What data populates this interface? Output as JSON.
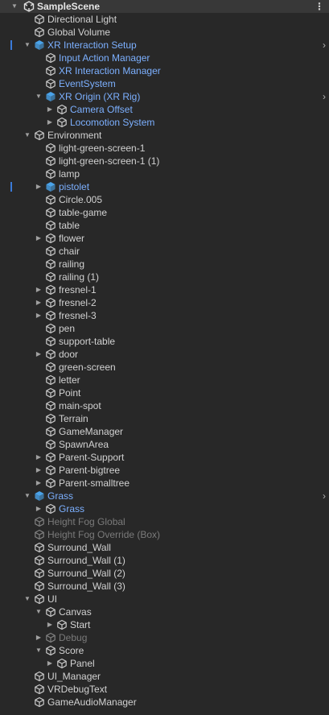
{
  "hierarchy": {
    "scene_name": "SampleScene",
    "menu_glyph": "⋮",
    "open_arrow": "▼",
    "closed_arrow": "▶",
    "prefab_enter_arrow": "›",
    "items": [
      {
        "label": "Directional Light",
        "depth": 1,
        "kind": "go"
      },
      {
        "label": "Global Volume",
        "depth": 1,
        "kind": "go"
      },
      {
        "label": "XR Interaction Setup",
        "depth": 1,
        "kind": "prefab",
        "expand": "open",
        "enter": true,
        "gutter": true
      },
      {
        "label": "Input Action Manager",
        "depth": 2,
        "kind": "go",
        "text": "prefab"
      },
      {
        "label": "XR Interaction Manager",
        "depth": 2,
        "kind": "go",
        "text": "prefab"
      },
      {
        "label": "EventSystem",
        "depth": 2,
        "kind": "go",
        "text": "prefab"
      },
      {
        "label": "XR Origin (XR Rig)",
        "depth": 2,
        "kind": "prefab",
        "expand": "open",
        "enter": true
      },
      {
        "label": "Camera Offset",
        "depth": 3,
        "kind": "go",
        "text": "prefab",
        "expand": "closed"
      },
      {
        "label": "Locomotion System",
        "depth": 3,
        "kind": "go",
        "text": "prefab",
        "expand": "closed"
      },
      {
        "label": "Environment",
        "depth": 1,
        "kind": "go",
        "expand": "open"
      },
      {
        "label": "light-green-screen-1",
        "depth": 2,
        "kind": "go"
      },
      {
        "label": "light-green-screen-1 (1)",
        "depth": 2,
        "kind": "go"
      },
      {
        "label": "lamp",
        "depth": 2,
        "kind": "go"
      },
      {
        "label": "pistolet",
        "depth": 2,
        "kind": "prefab-variant",
        "expand": "closed",
        "gutter": true
      },
      {
        "label": "Circle.005",
        "depth": 2,
        "kind": "go"
      },
      {
        "label": "table-game",
        "depth": 2,
        "kind": "go"
      },
      {
        "label": "table",
        "depth": 2,
        "kind": "go"
      },
      {
        "label": "flower",
        "depth": 2,
        "kind": "go",
        "expand": "closed"
      },
      {
        "label": "chair",
        "depth": 2,
        "kind": "go"
      },
      {
        "label": "railing",
        "depth": 2,
        "kind": "go"
      },
      {
        "label": "railing (1)",
        "depth": 2,
        "kind": "go"
      },
      {
        "label": "fresnel-1",
        "depth": 2,
        "kind": "go",
        "expand": "closed"
      },
      {
        "label": "fresnel-2",
        "depth": 2,
        "kind": "go",
        "expand": "closed"
      },
      {
        "label": "fresnel-3",
        "depth": 2,
        "kind": "go",
        "expand": "closed"
      },
      {
        "label": "pen",
        "depth": 2,
        "kind": "go"
      },
      {
        "label": "support-table",
        "depth": 2,
        "kind": "go"
      },
      {
        "label": "door",
        "depth": 2,
        "kind": "go",
        "expand": "closed"
      },
      {
        "label": "green-screen",
        "depth": 2,
        "kind": "go"
      },
      {
        "label": "letter",
        "depth": 2,
        "kind": "go"
      },
      {
        "label": "Point",
        "depth": 2,
        "kind": "go"
      },
      {
        "label": "main-spot",
        "depth": 2,
        "kind": "go"
      },
      {
        "label": "Terrain",
        "depth": 2,
        "kind": "go"
      },
      {
        "label": "GameManager",
        "depth": 2,
        "kind": "go"
      },
      {
        "label": "SpawnArea",
        "depth": 2,
        "kind": "go"
      },
      {
        "label": "Parent-Support",
        "depth": 2,
        "kind": "go",
        "expand": "closed"
      },
      {
        "label": "Parent-bigtree",
        "depth": 2,
        "kind": "go",
        "expand": "closed"
      },
      {
        "label": "Parent-smalltree",
        "depth": 2,
        "kind": "go",
        "expand": "closed"
      },
      {
        "label": "Grass",
        "depth": 1,
        "kind": "prefab",
        "expand": "open",
        "enter": true
      },
      {
        "label": "Grass",
        "depth": 2,
        "kind": "go",
        "text": "prefab",
        "expand": "closed"
      },
      {
        "label": "Height Fog Global",
        "depth": 1,
        "kind": "go",
        "disabled": true
      },
      {
        "label": "Height Fog Override (Box)",
        "depth": 1,
        "kind": "go",
        "disabled": true
      },
      {
        "label": "Surround_Wall",
        "depth": 1,
        "kind": "go"
      },
      {
        "label": "Surround_Wall (1)",
        "depth": 1,
        "kind": "go"
      },
      {
        "label": "Surround_Wall (2)",
        "depth": 1,
        "kind": "go"
      },
      {
        "label": "Surround_Wall (3)",
        "depth": 1,
        "kind": "go"
      },
      {
        "label": "UI",
        "depth": 1,
        "kind": "go",
        "expand": "open"
      },
      {
        "label": "Canvas",
        "depth": 2,
        "kind": "go",
        "expand": "open"
      },
      {
        "label": "Start",
        "depth": 3,
        "kind": "go",
        "expand": "closed"
      },
      {
        "label": "Debug",
        "depth": 2,
        "kind": "go",
        "expand": "closed",
        "disabled": true
      },
      {
        "label": "Score",
        "depth": 2,
        "kind": "go",
        "expand": "open"
      },
      {
        "label": "Panel",
        "depth": 3,
        "kind": "go",
        "expand": "closed"
      },
      {
        "label": "UI_Manager",
        "depth": 1,
        "kind": "go"
      },
      {
        "label": "VRDebugText",
        "depth": 1,
        "kind": "go"
      },
      {
        "label": "GameAudioManager",
        "depth": 1,
        "kind": "go"
      }
    ]
  },
  "colors": {
    "background": "#282828",
    "header": "#383838",
    "text": "#d2d2d2",
    "prefab_text": "#7cb0ff",
    "disabled_text": "#7a7a7a",
    "prefab_icon": "#4aa3ea",
    "go_icon": "#c8c8c8",
    "gutter_mark": "#3a7ad8"
  }
}
